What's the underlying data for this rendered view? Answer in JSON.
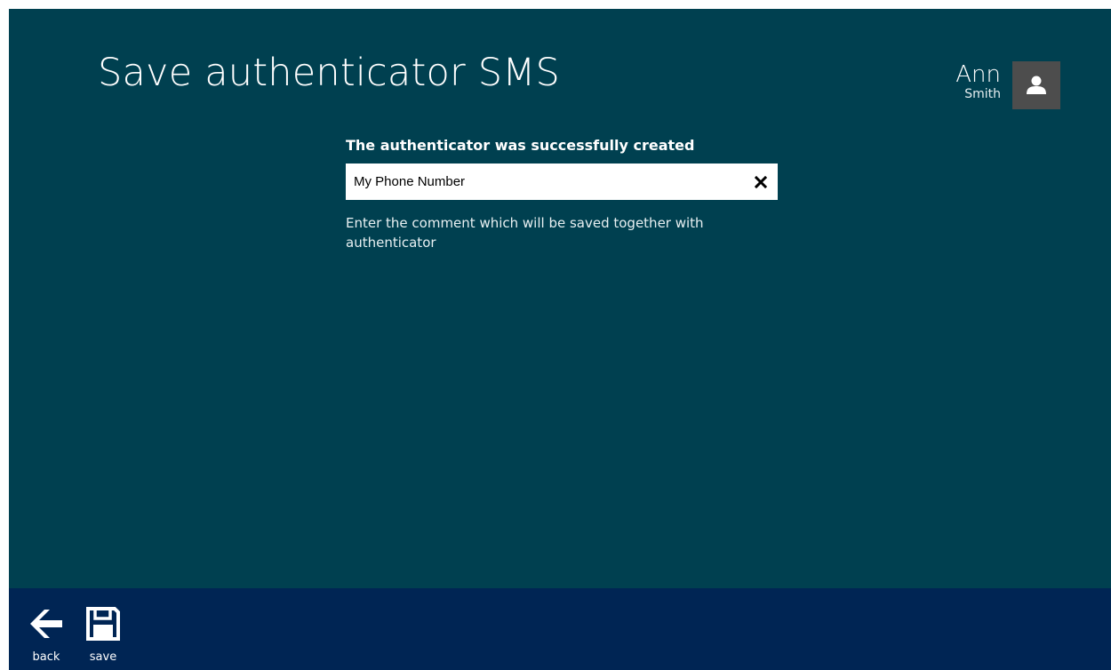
{
  "page": {
    "title": "Save authenticator SMS"
  },
  "user": {
    "first_name": "Ann",
    "last_name": "Smith",
    "avatar_icon": "user-icon"
  },
  "form": {
    "status_heading": "The authenticator was successfully created",
    "comment_value": "My Phone Number",
    "clear_icon": "close-icon",
    "help_text": "Enter the comment which will be saved together with authenticator"
  },
  "app_bar": {
    "back": {
      "label": "back",
      "icon": "arrow-left-icon"
    },
    "save": {
      "label": "save",
      "icon": "floppy-disk-icon"
    }
  },
  "colors": {
    "page_background": "#004050",
    "app_bar_background": "#002554",
    "avatar_background": "#4d4d4d",
    "text": "#ffffff"
  }
}
